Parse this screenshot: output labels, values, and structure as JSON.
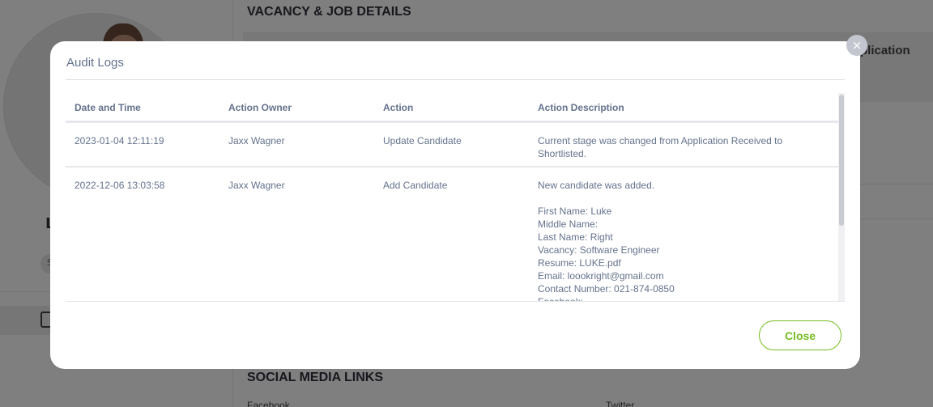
{
  "background": {
    "vacancy_section_title": "VACANCY & JOB DETAILS",
    "stage_label_partial": "plication",
    "social_section_title": "SOCIAL MEDIA LINKS",
    "facebook_label": "Facebook",
    "twitter_label": "Twitter",
    "name_initial": "L",
    "chip_text": "S"
  },
  "modal": {
    "title": "Audit Logs",
    "close_icon_glyph": "×",
    "close_button_label": "Close",
    "accent_color": "#76bc21",
    "table": {
      "columns": [
        "Date and Time",
        "Action Owner",
        "Action",
        "Action Description"
      ],
      "rows": [
        {
          "datetime": "2023-01-04 12:11:19",
          "owner": "Jaxx Wagner",
          "action": "Update Candidate",
          "description": [
            "Current stage was changed from Application Received to Shortlisted."
          ]
        },
        {
          "datetime": "2022-12-06 13:03:58",
          "owner": "Jaxx Wagner",
          "action": "Add Candidate",
          "description": [
            "New candidate was added.",
            "",
            "First Name: Luke",
            "Middle Name:",
            "Last Name: Right",
            "Vacancy: Software Engineer",
            "Resume: LUKE.pdf",
            "Email: loookright@gmail.com",
            "Contact Number: 021-874-0850",
            "Facebook:"
          ]
        }
      ]
    }
  }
}
